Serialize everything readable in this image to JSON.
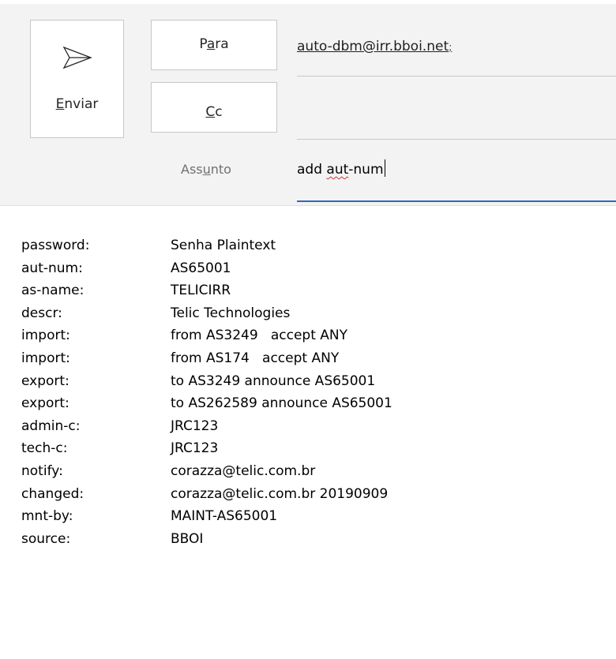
{
  "compose": {
    "send_label": "Enviar",
    "send_mnemonic_index": 0,
    "to_label": "Para",
    "cc_label": "Cc",
    "subject_label": "Assunto",
    "to_value": "auto-dbm@irr.bboi.net",
    "to_separator": ";",
    "cc_value": "",
    "subject_prefix": "add ",
    "subject_misspelled": "aut",
    "subject_suffix": "-num"
  },
  "icons": {
    "send": "send-arrow-icon"
  },
  "colors": {
    "header_bg": "#f3f3f3",
    "subject_focus_line": "#2b6cb8",
    "spellcheck": "#d13438"
  },
  "body": {
    "lines": [
      {
        "key": "password:",
        "value": "Senha Plaintext"
      },
      {
        "key": "aut-num:",
        "value": "AS65001"
      },
      {
        "key": "as-name:",
        "value": "TELICIRR"
      },
      {
        "key": "descr:",
        "value": "Telic Technologies"
      },
      {
        "key": "import:",
        "value": "from AS3249   accept ANY"
      },
      {
        "key": "import:",
        "value": "from AS174   accept ANY"
      },
      {
        "key": "export:",
        "value": "to AS3249 announce AS65001"
      },
      {
        "key": "export:",
        "value": "to AS262589 announce AS65001"
      },
      {
        "key": "admin-c:",
        "value": "JRC123"
      },
      {
        "key": "tech-c:",
        "value": "JRC123"
      },
      {
        "key": "notify:",
        "value": "corazza@telic.com.br"
      },
      {
        "key": "changed:",
        "value": "corazza@telic.com.br 20190909"
      },
      {
        "key": "mnt-by:",
        "value": "MAINT-AS65001"
      },
      {
        "key": "source:",
        "value": "BBOI"
      }
    ]
  }
}
